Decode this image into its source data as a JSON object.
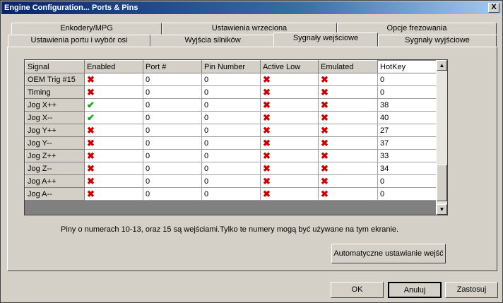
{
  "window": {
    "title": "Engine Configuration... Ports & Pins",
    "close_label": "X"
  },
  "tabs_row1": [
    {
      "label": "Enkodery/MPG"
    },
    {
      "label": "Ustawienia wrzeciona"
    },
    {
      "label": "Opcje frezowania"
    }
  ],
  "tabs_row2": [
    {
      "label": "Ustawienia portu i wybór osi"
    },
    {
      "label": "Wyjścia silników"
    },
    {
      "label": "Sygnały wejściowe"
    },
    {
      "label": "Sygnały wyjściowe"
    }
  ],
  "grid": {
    "headers": [
      "Signal",
      "Enabled",
      "Port #",
      "Pin Number",
      "Active Low",
      "Emulated",
      "HotKey"
    ],
    "rows": [
      {
        "signal": "OEM Trig #15",
        "enabled": "x",
        "port": "0",
        "pin": "0",
        "active_low": "x",
        "emulated": "x",
        "hotkey": "0"
      },
      {
        "signal": "Timing",
        "enabled": "x",
        "port": "0",
        "pin": "0",
        "active_low": "x",
        "emulated": "x",
        "hotkey": "0"
      },
      {
        "signal": "Jog X++",
        "enabled": "check",
        "port": "0",
        "pin": "0",
        "active_low": "x",
        "emulated": "x",
        "hotkey": "38"
      },
      {
        "signal": "Jog X--",
        "enabled": "check",
        "port": "0",
        "pin": "0",
        "active_low": "x",
        "emulated": "x",
        "hotkey": "40"
      },
      {
        "signal": "Jog Y++",
        "enabled": "x",
        "port": "0",
        "pin": "0",
        "active_low": "x",
        "emulated": "x",
        "hotkey": "27"
      },
      {
        "signal": "Jog Y--",
        "enabled": "x",
        "port": "0",
        "pin": "0",
        "active_low": "x",
        "emulated": "x",
        "hotkey": "37"
      },
      {
        "signal": "Jog Z++",
        "enabled": "x",
        "port": "0",
        "pin": "0",
        "active_low": "x",
        "emulated": "x",
        "hotkey": "33"
      },
      {
        "signal": "Jog Z--",
        "enabled": "x",
        "port": "0",
        "pin": "0",
        "active_low": "x",
        "emulated": "x",
        "hotkey": "34"
      },
      {
        "signal": "Jog A++",
        "enabled": "x",
        "port": "0",
        "pin": "0",
        "active_low": "x",
        "emulated": "x",
        "hotkey": "0"
      },
      {
        "signal": "Jog A--",
        "enabled": "x",
        "port": "0",
        "pin": "0",
        "active_low": "x",
        "emulated": "x",
        "hotkey": "0"
      }
    ]
  },
  "info_text": "Piny o numerach 10-13, oraz 15 są wejściami.Tylko te numery mogą być używane na tym ekranie.",
  "buttons": {
    "auto": "Automatyczne ustawianie wejść",
    "ok": "OK",
    "cancel": "Anuluj",
    "apply": "Zastosuj"
  },
  "icons": {
    "x": "red-x-icon",
    "check": "green-check-icon"
  },
  "colors": {
    "x": "#cc0000",
    "check": "#00aa00",
    "title_bar": "#0a246a"
  }
}
